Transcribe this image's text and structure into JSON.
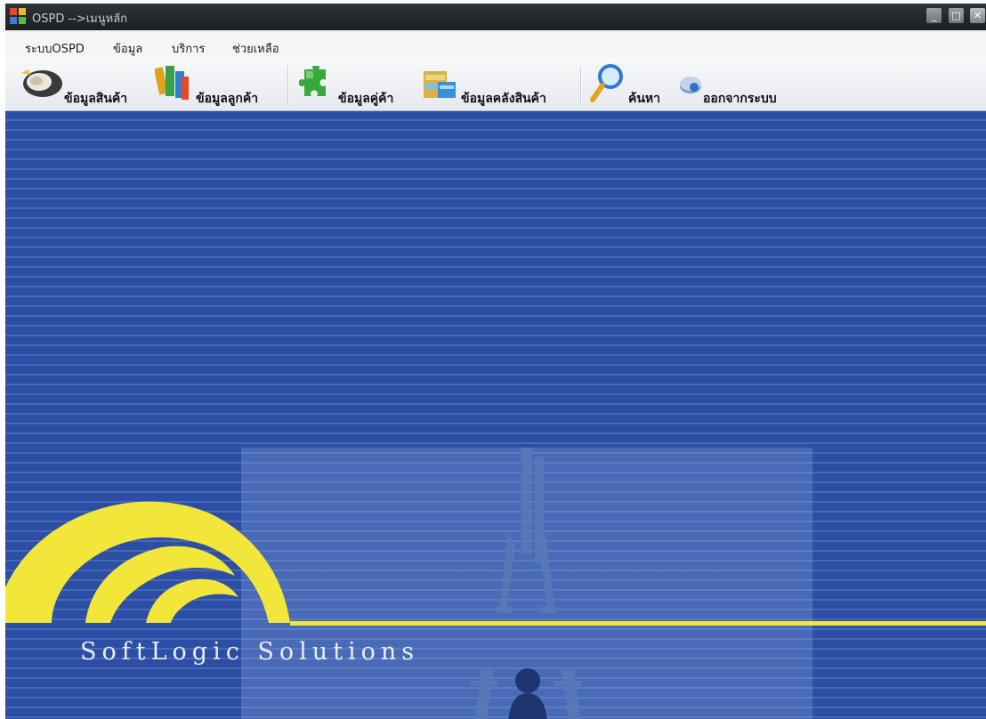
{
  "window": {
    "title": "OSPD -->เมนูหลัก",
    "controls": {
      "minimize": "_",
      "maximize": "□",
      "close": "✕"
    }
  },
  "menu": {
    "items": [
      "ระบบOSPD",
      "ข้อมูล",
      "บริการ",
      "ช่วยเหลือ"
    ]
  },
  "toolbar": {
    "buttons": [
      {
        "label": "ข้อมูลสินค้า",
        "icon": "speaker-icon"
      },
      {
        "label": "ข้อมูลลูกค้า",
        "icon": "books-icon"
      },
      {
        "label": "ข้อมูลคู่ค้า",
        "icon": "puzzle-icon"
      },
      {
        "label": "ข้อมูลคลังสินค้า",
        "icon": "warehouse-icon"
      },
      {
        "label": "ค้นหา",
        "icon": "magnifier-icon"
      },
      {
        "label": "ออกจากระบบ",
        "icon": "exit-icon"
      }
    ]
  },
  "main": {
    "company_name": "SoftLogic  Solutions",
    "colors": {
      "background": "#2c4fa5",
      "logo": "#f2e63a"
    }
  }
}
